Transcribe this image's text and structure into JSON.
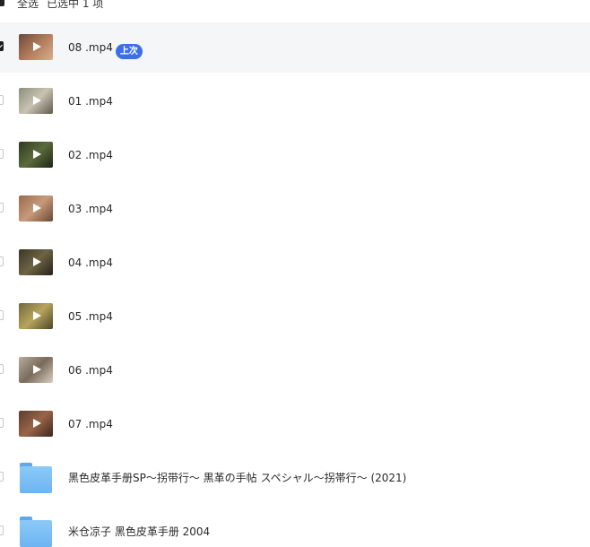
{
  "toolbar": {
    "select_all_label": "全选",
    "selected_count_label": "已选中 1 项"
  },
  "colors": {
    "accent": "#3b6fea",
    "selected_row_bg": "#f5f6f8",
    "folder": "#7cbff5"
  },
  "files": [
    {
      "name": "08 .mp4",
      "type": "video",
      "selected": true,
      "badge": "上次",
      "thumb_colors": [
        "#6b4a3c",
        "#b27a5c",
        "#d6b08e"
      ]
    },
    {
      "name": "01 .mp4",
      "type": "video",
      "selected": false,
      "badge": "",
      "thumb_colors": [
        "#8a8f7c",
        "#c9c3b1",
        "#5e5a4d"
      ]
    },
    {
      "name": "02 .mp4",
      "type": "video",
      "selected": false,
      "badge": "",
      "thumb_colors": [
        "#2f3a22",
        "#5b6b3a",
        "#1f2416"
      ]
    },
    {
      "name": "03 .mp4",
      "type": "video",
      "selected": false,
      "badge": "",
      "thumb_colors": [
        "#9a6a4e",
        "#c79a7a",
        "#6e4634"
      ]
    },
    {
      "name": "04 .mp4",
      "type": "video",
      "selected": false,
      "badge": "",
      "thumb_colors": [
        "#3a3626",
        "#6e6444",
        "#24211a"
      ]
    },
    {
      "name": "05 .mp4",
      "type": "video",
      "selected": false,
      "badge": "",
      "thumb_colors": [
        "#6e6a3c",
        "#b8a45c",
        "#4a4626"
      ]
    },
    {
      "name": "06 .mp4",
      "type": "video",
      "selected": false,
      "badge": "",
      "thumb_colors": [
        "#b6ad9e",
        "#7a6a5a",
        "#d8d0c2"
      ]
    },
    {
      "name": "07 .mp4",
      "type": "video",
      "selected": false,
      "badge": "",
      "thumb_colors": [
        "#5c3c2e",
        "#9a6448",
        "#3a2620"
      ]
    },
    {
      "name": "黑色皮革手册SP～拐带行～ 黒革の手帖 スペシャル～拐帯行～ (2021)",
      "type": "folder",
      "selected": false,
      "badge": ""
    },
    {
      "name": "米仓凉子 黑色皮革手册 2004",
      "type": "folder",
      "selected": false,
      "badge": ""
    }
  ]
}
